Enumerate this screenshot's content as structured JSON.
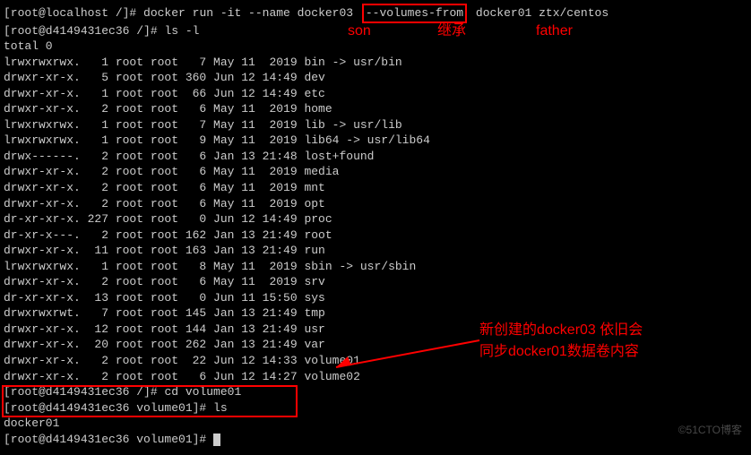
{
  "line1": {
    "prompt_open": "[root@localhost /]# ",
    "cmd_pre": "docker run -it --name docker03 ",
    "cmd_highlight": "--volumes-from",
    "cmd_post": " docker01 ztx/centos"
  },
  "line2": {
    "prompt": "[root@d4149431ec36 /]# ",
    "cmd": "ls -l"
  },
  "total": "total 0",
  "listing": [
    "lrwxrwxrwx.   1 root root   7 May 11  2019 bin -> usr/bin",
    "drwxr-xr-x.   5 root root 360 Jun 12 14:49 dev",
    "drwxr-xr-x.   1 root root  66 Jun 12 14:49 etc",
    "drwxr-xr-x.   2 root root   6 May 11  2019 home",
    "lrwxrwxrwx.   1 root root   7 May 11  2019 lib -> usr/lib",
    "lrwxrwxrwx.   1 root root   9 May 11  2019 lib64 -> usr/lib64",
    "drwx------.   2 root root   6 Jan 13 21:48 lost+found",
    "drwxr-xr-x.   2 root root   6 May 11  2019 media",
    "drwxr-xr-x.   2 root root   6 May 11  2019 mnt",
    "drwxr-xr-x.   2 root root   6 May 11  2019 opt",
    "dr-xr-xr-x. 227 root root   0 Jun 12 14:49 proc",
    "dr-xr-x---.   2 root root 162 Jan 13 21:49 root",
    "drwxr-xr-x.  11 root root 163 Jan 13 21:49 run",
    "lrwxrwxrwx.   1 root root   8 May 11  2019 sbin -> usr/sbin",
    "drwxr-xr-x.   2 root root   6 May 11  2019 srv",
    "dr-xr-xr-x.  13 root root   0 Jun 11 15:50 sys",
    "drwxrwxrwt.   7 root root 145 Jan 13 21:49 tmp",
    "drwxr-xr-x.  12 root root 144 Jan 13 21:49 usr",
    "drwxr-xr-x.  20 root root 262 Jan 13 21:49 var",
    "drwxr-xr-x.   2 root root  22 Jun 12 14:33 volume01",
    "drwxr-xr-x.   2 root root   6 Jun 12 14:27 volume02"
  ],
  "line_cd": {
    "prompt": "[root@d4149431ec36 /]# ",
    "cmd": "cd volume01"
  },
  "line_ls2": {
    "prompt": "[root@d4149431ec36 volume01]# ",
    "cmd": "ls"
  },
  "ls_output": "docker01",
  "line_final": {
    "prompt": "[root@d4149431ec36 volume01]# "
  },
  "annotations": {
    "son": "son",
    "inherit": "继承",
    "father": "father",
    "comment1": "新创建的docker03 依旧会",
    "comment2": "同步docker01数据卷内容"
  },
  "watermark": "©51CTO博客"
}
